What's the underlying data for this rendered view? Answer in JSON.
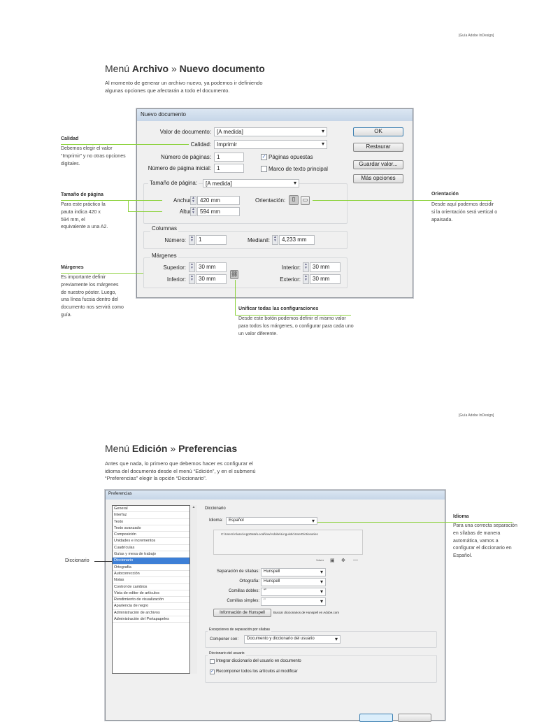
{
  "page1": {
    "header": "[Guía Adobe InDesign]",
    "title_prefix": "Menú",
    "title_a": "Archivo",
    "title_sep": "»",
    "title_b": "Nuevo documento",
    "intro": "Al momento de generar un archivo nuevo, ya podemos ir definiendo algunas opciones que afectarán a todo el documento.",
    "dialog": {
      "title": "Nuevo documento",
      "valor_label": "Valor de documento:",
      "valor_value": "[A medida]",
      "calidad_label": "Calidad:",
      "calidad_value": "Imprimir",
      "num_paginas_label": "Número de páginas:",
      "num_paginas_value": "1",
      "pagina_inicial_label": "Número de página inicial:",
      "pagina_inicial_value": "1",
      "paginas_opuestas": "Páginas opuestas",
      "paginas_opuestas_checked": true,
      "marco_texto": "Marco de texto principal",
      "marco_texto_checked": false,
      "buttons": {
        "ok": "OK",
        "restaurar": "Restaurar",
        "guardar": "Guardar valor...",
        "mas": "Más opciones"
      },
      "tamano_label": "Tamaño de página:",
      "tamano_value": "[A medida]",
      "anchura_label": "Anchura:",
      "anchura_value": "420 mm",
      "altura_label": "Altura:",
      "altura_value": "594 mm",
      "orientacion_label": "Orientación:",
      "columnas_title": "Columnas",
      "numero_label": "Número:",
      "numero_value": "1",
      "medianil_label": "Medianil:",
      "medianil_value": "4,233 mm",
      "margenes_title": "Márgenes",
      "superior_label": "Superior:",
      "superior_value": "30 mm",
      "inferior_label": "Inferior:",
      "inferior_value": "30 mm",
      "interior_label": "Interior:",
      "interior_value": "30 mm",
      "exterior_label": "Exterior:",
      "exterior_value": "30 mm"
    },
    "callouts": {
      "calidad": {
        "title": "Calidad",
        "text": "Debemos elegir el valor “Imprimir” y no otras opciones digitales."
      },
      "tamano": {
        "title": "Tamaño de página",
        "text": "Para este práctico la pauta indica 420 x 594 mm, el equivalente a una A2."
      },
      "margenes": {
        "title": "Márgenes",
        "text": "Es importante definir previamente los márgenes de nuestro póster. Luego, una línea fucsia dentro del documento nos servirá como guía."
      },
      "orientacion": {
        "title": "Orientación",
        "text": "Desde aquí podemos decidir si la orientación será vertical o apaisada."
      },
      "unificar": {
        "title": "Unificar todas las configuraciones",
        "text": "Desde este botón podemos definir el mismo valor para todos los márgenes, o configurar para cada uno un valor diferente."
      }
    }
  },
  "page2": {
    "header": "[Guía Adobe InDesign]",
    "title_prefix": "Menú",
    "title_a": "Edición",
    "title_sep": "»",
    "title_b": "Preferencias",
    "intro": "Antes que nada, lo primero que debemos hacer es configurar el idioma del documento desde el menú “Edición”, y en el submenú “Preferencias” elegir la opción “Diccionario”.",
    "dialog": {
      "title": "Preferencias",
      "list": [
        "General",
        "Interfaz",
        "Texto",
        "Texto avanzado",
        "Composición",
        "Unidades e incrementos",
        "Cuadrículas",
        "Guías y mesa de trabajo",
        "Diccionario",
        "Ortografía",
        "Autocorrección",
        "Notas",
        "Control de cambios",
        "Vista de editor de artículos",
        "Rendimiento de visualización",
        "Apariencia de negro",
        "Administración de archivos",
        "Administración del Portapapeles"
      ],
      "selected": "Diccionario",
      "section": "Diccionario",
      "idioma_label": "Idioma:",
      "idioma_value": "Español",
      "path": "C:\\Users\\Alvaro\\AppData\\Local\\low\\Adobe\\Linguistic\\UserDictionaries",
      "path_tools_label": "Volver",
      "silabas_label": "Separación de sílabas:",
      "silabas_value": "Hunspell",
      "ortografia_label": "Ortografía:",
      "ortografia_value": "Hunspell",
      "dobles_label": "Comillas dobles:",
      "dobles_value": "“”",
      "simples_label": "Comillas simples:",
      "simples_value": "‘’",
      "hunspell_button": "Información de Hunspell",
      "hunspell_link": "Buscar diccionarios de Hunspell en Adobe.com",
      "excepciones_title": "Excepciones de separación por sílabas",
      "componer_label": "Componer con:",
      "componer_value": "Documento y diccionario del usuario",
      "usuario_title": "Diccionario del usuario",
      "integrar": "Integrar diccionario del usuario en documento",
      "integrar_checked": false,
      "recomponer": "Recomponer todos los artículos al modificar",
      "recomponer_checked": true
    },
    "callouts": {
      "idioma": {
        "title": "Idioma",
        "text": "Para una correcta separación en sílabas de manera automática, vamos a configurar el diccionario en Español."
      },
      "diccionario": {
        "title": "Diccionario"
      }
    }
  },
  "colors": {
    "accent": "#8cd23c",
    "selection": "#3d7fd6"
  }
}
